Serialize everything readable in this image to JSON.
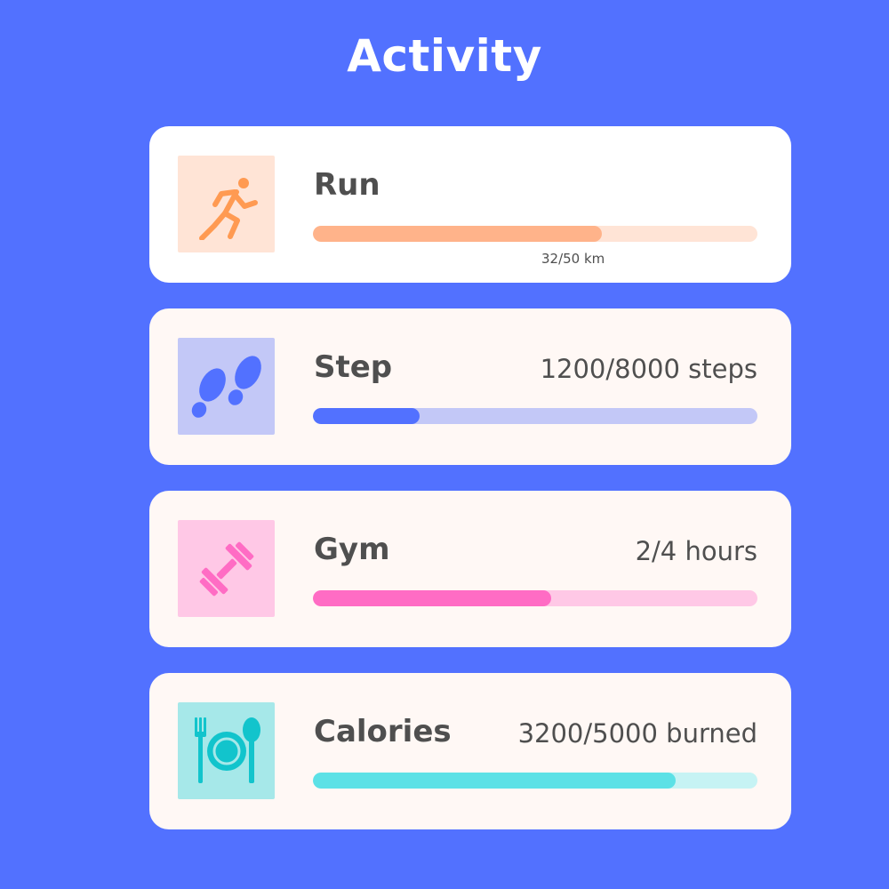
{
  "page": {
    "title": "Activity",
    "background": "#5271FF"
  },
  "activities": [
    {
      "id": "run",
      "label": "Run",
      "value": "32/50 km",
      "progress": 0.65,
      "fill_color": "#FFB38A",
      "track_color": "#FFE4D6",
      "icon_bg": "#FFE4D6",
      "icon_color": "#FF9A52",
      "icon": "running-person-icon",
      "card": "white",
      "value_position": "below-bar"
    },
    {
      "id": "step",
      "label": "Step",
      "value": "1200/8000 steps",
      "progress": 0.24,
      "fill_color": "#5271FF",
      "track_color": "#C3C8F7",
      "icon_bg": "#C3C8F7",
      "icon_color": "#5271FF",
      "icon": "footprints-icon",
      "card": "cream",
      "value_position": "right"
    },
    {
      "id": "gym",
      "label": "Gym",
      "value": "2/4 hours",
      "progress": 0.535,
      "fill_color": "#FF6CC4",
      "track_color": "#FFC8E6",
      "icon_bg": "#FFC8E6",
      "icon_color": "#FF6CC4",
      "icon": "dumbbell-icon",
      "card": "cream",
      "value_position": "right"
    },
    {
      "id": "calories",
      "label": "Calories",
      "value": "3200/5000 burned",
      "progress": 0.815,
      "fill_color": "#5CE1E6",
      "track_color": "#C6F3F4",
      "icon_bg": "#A6E8E9",
      "icon_color": "#12C4CC",
      "icon": "plate-cutlery-icon",
      "card": "cream",
      "value_position": "right"
    }
  ]
}
